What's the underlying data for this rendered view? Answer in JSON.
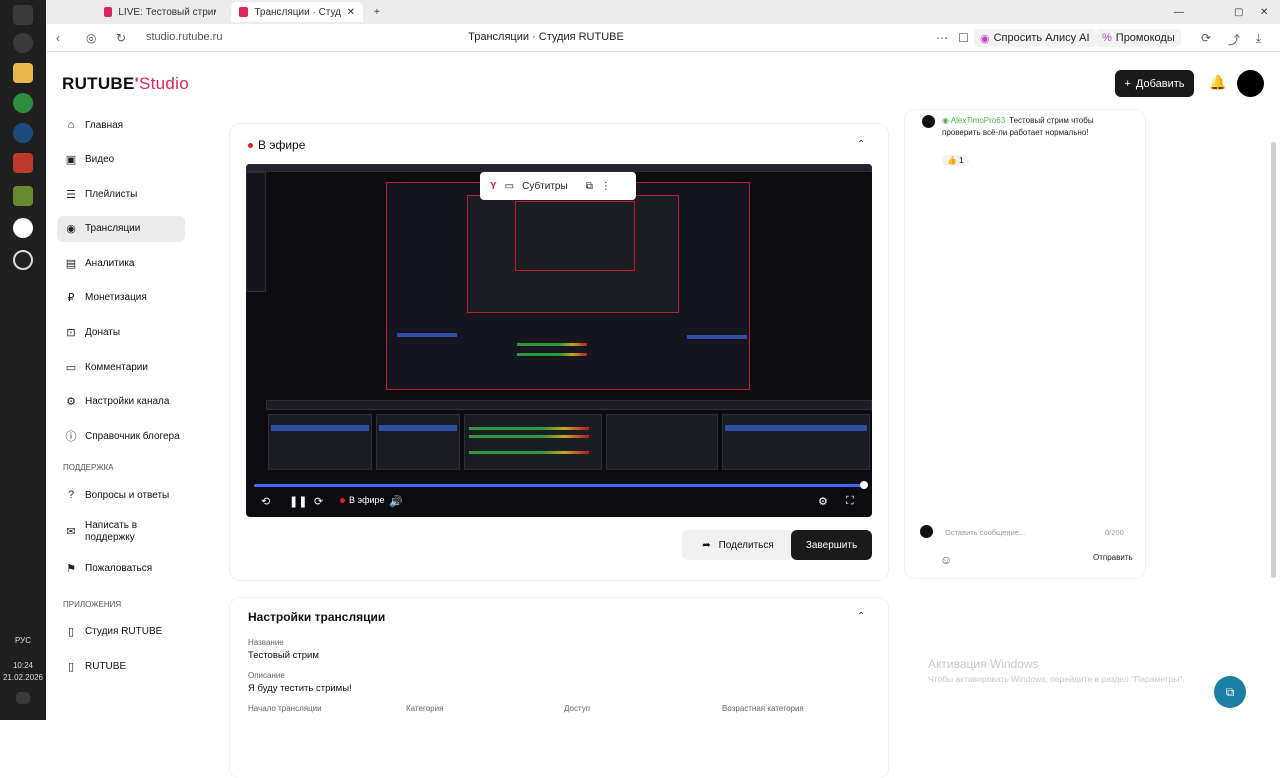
{
  "taskbar": {
    "lang": "РУС",
    "time": "10:24",
    "date": "21.02.2026"
  },
  "browser": {
    "tabs": [
      {
        "label": "LIVE: Тестовый стрим см"
      },
      {
        "label": "Трансляции · Студи"
      }
    ],
    "url": "studio.rutube.ru",
    "page_title": "Трансляции · Студия RUTUBE",
    "alice_label": "Спросить Алису AI",
    "promo_label": "Промокоды"
  },
  "header": {
    "logo_main": "RUTUBE",
    "logo_sub": "Studio",
    "add_label": "Добавить"
  },
  "sidebar": {
    "items": [
      {
        "label": "Главная",
        "icon": "home-icon"
      },
      {
        "label": "Видео",
        "icon": "video-icon"
      },
      {
        "label": "Плейлисты",
        "icon": "playlist-icon"
      },
      {
        "label": "Трансляции",
        "icon": "broadcast-icon"
      },
      {
        "label": "Аналитика",
        "icon": "analytics-icon"
      },
      {
        "label": "Монетизация",
        "icon": "money-icon"
      },
      {
        "label": "Донаты",
        "icon": "donate-icon"
      },
      {
        "label": "Комментарии",
        "icon": "comments-icon"
      },
      {
        "label": "Настройки канала",
        "icon": "gear-icon"
      },
      {
        "label": "Справочник блогера",
        "icon": "info-icon"
      }
    ],
    "support_label": "ПОДДЕРЖКА",
    "support_items": [
      {
        "label": "Вопросы и ответы"
      },
      {
        "label": "Написать в поддержку"
      },
      {
        "label": "Пожаловаться"
      }
    ],
    "apps_label": "ПРИЛОЖЕНИЯ",
    "apps_items": [
      {
        "label": "Студия RUTUBE"
      },
      {
        "label": "RUTUBE"
      }
    ]
  },
  "live": {
    "title": "В эфире",
    "subtitles_label": "Субтитры",
    "live_badge": "В эфире",
    "share_label": "Поделиться",
    "end_label": "Завершить"
  },
  "settings": {
    "title": "Настройки трансляции",
    "name_label": "Название",
    "name_value": "Тестовый стрим",
    "desc_label": "Описание",
    "desc_value": "Я буду тестить стримы!",
    "start_label": "Начало трансляции",
    "category_label": "Категория",
    "access_label": "Доступ",
    "age_label": "Возрастная категория"
  },
  "chat": {
    "author": "AlexTimoPro63",
    "message": "Тестовый стрим чтобы проверить всё-ли работает нормально!",
    "reaction": "👍 1",
    "input_placeholder": "Оставить сообщение...",
    "counter": "0/200",
    "send_label": "Отправить"
  },
  "windows_activation": {
    "title": "Активация Windows",
    "subtitle": "Чтобы активировать Windows, перейдите в раздел \"Параметры\"."
  }
}
